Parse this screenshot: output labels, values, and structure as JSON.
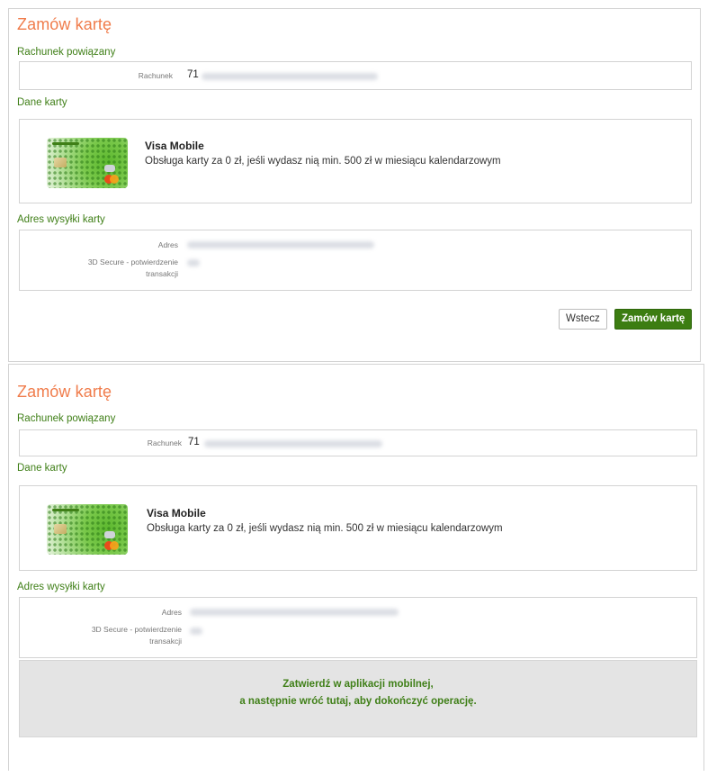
{
  "screens": [
    {
      "title": "Zamów kartę",
      "linked_account_section": "Rachunek powiązany",
      "account_label": "Rachunek",
      "account_prefix": "71",
      "card_section": "Dane karty",
      "card_name": "Visa Mobile",
      "card_description": "Obsługa karty za 0 zł, jeśli wydasz nią min. 500 zł w miesiącu kalendarzowym",
      "address_section": "Adres wysyłki karty",
      "address_label": "Adres",
      "secure_label_line1": "3D Secure - potwierdzenie",
      "secure_label_line2": "transakcji",
      "back_button": "Wstecz",
      "order_button": "Zamów kartę"
    },
    {
      "title": "Zamów kartę",
      "linked_account_section": "Rachunek powiązany",
      "account_label": "Rachunek",
      "account_prefix": "71",
      "card_section": "Dane karty",
      "card_name": "Visa Mobile",
      "card_description": "Obsługa karty za 0 zł, jeśli wydasz nią min. 500 zł w miesiącu kalendarzowym",
      "address_section": "Adres wysyłki karty",
      "address_label": "Adres",
      "secure_label_line1": "3D Secure - potwierdzenie",
      "secure_label_line2": "transakcji",
      "confirm_line1": "Zatwierdź w aplikacji mobilnej,",
      "confirm_line2": "a następnie wróć tutaj, aby dokończyć operację."
    }
  ],
  "colors": {
    "title": "#f07c4b",
    "section": "#3f7f17",
    "primary_button": "#3c7d12",
    "confirm_background": "#e4e4e4"
  },
  "icons": {
    "card_image": "visa-mobile-card-image"
  }
}
